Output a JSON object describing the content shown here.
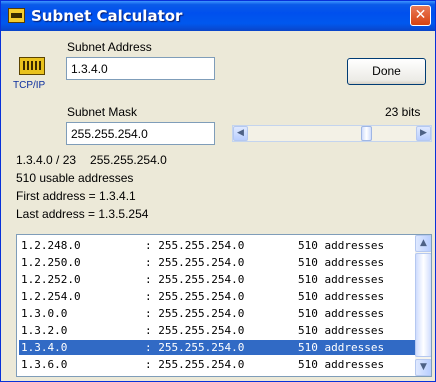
{
  "window": {
    "title": "Subnet Calculator",
    "close_glyph": "✕",
    "title_icon": "calculator-icon"
  },
  "form": {
    "icon": "network-card-icon",
    "icon_caption": "TCP/IP",
    "subnet_address_label": "Subnet Address",
    "subnet_address_value": "1.3.4.0",
    "subnet_mask_label": "Subnet Mask",
    "subnet_mask_value": "255.255.254.0",
    "bits_label": "23 bits",
    "bits": 23,
    "done_label": "Done"
  },
  "summary": {
    "cidr": "1.3.4.0 / 23",
    "mask": "255.255.254.0",
    "usable": "510 usable addresses",
    "first": "First address = 1.3.4.1",
    "last": "Last address = 1.3.5.254"
  },
  "subnets": [
    {
      "address": "1.2.248.0",
      "mask": ": 255.255.254.0",
      "count": "510 addresses",
      "selected": false
    },
    {
      "address": "1.2.250.0",
      "mask": ": 255.255.254.0",
      "count": "510 addresses",
      "selected": false
    },
    {
      "address": "1.2.252.0",
      "mask": ": 255.255.254.0",
      "count": "510 addresses",
      "selected": false
    },
    {
      "address": "1.2.254.0",
      "mask": ": 255.255.254.0",
      "count": "510 addresses",
      "selected": false
    },
    {
      "address": "1.3.0.0",
      "mask": ": 255.255.254.0",
      "count": "510 addresses",
      "selected": false
    },
    {
      "address": "1.3.2.0",
      "mask": ": 255.255.254.0",
      "count": "510 addresses",
      "selected": false
    },
    {
      "address": "1.3.4.0",
      "mask": ": 255.255.254.0",
      "count": "510 addresses",
      "selected": true
    },
    {
      "address": "1.3.6.0",
      "mask": ": 255.255.254.0",
      "count": "510 addresses",
      "selected": false
    }
  ],
  "scroll": {
    "left_arrow": "◀",
    "right_arrow": "▶",
    "up_arrow": "▲",
    "down_arrow": "▼"
  },
  "colors": {
    "selection": "#316ac5",
    "titlebar": "#0058ee",
    "close_button": "#d7420f"
  }
}
